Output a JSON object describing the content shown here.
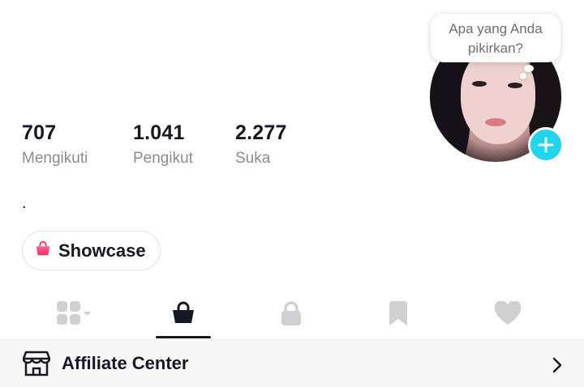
{
  "profile": {
    "stats": [
      {
        "value": "707",
        "label": "Mengikuti"
      },
      {
        "value": "1.041",
        "label": "Pengikut"
      },
      {
        "value": "2.277",
        "label": "Suka"
      }
    ],
    "bio": ".",
    "bubble_line1": "Apa yang Anda",
    "bubble_line2": "pikirkan?"
  },
  "showcase": {
    "label": "Showcase",
    "icon": "shopping-bag-icon"
  },
  "tabs": [
    {
      "icon": "grid-icon",
      "selected": false
    },
    {
      "icon": "shopping-bag-icon",
      "selected": true
    },
    {
      "icon": "lock-icon",
      "selected": false
    },
    {
      "icon": "bookmark-icon",
      "selected": false
    },
    {
      "icon": "heart-icon",
      "selected": false
    }
  ],
  "affiliate": {
    "label": "Affiliate Center",
    "icon": "store-icon"
  },
  "colors": {
    "accent": "#20d5ec",
    "text": "#161823",
    "muted": "#8a8b91",
    "tab_inactive": "#d0d0d2",
    "bag_pink": "#fe2c55"
  }
}
